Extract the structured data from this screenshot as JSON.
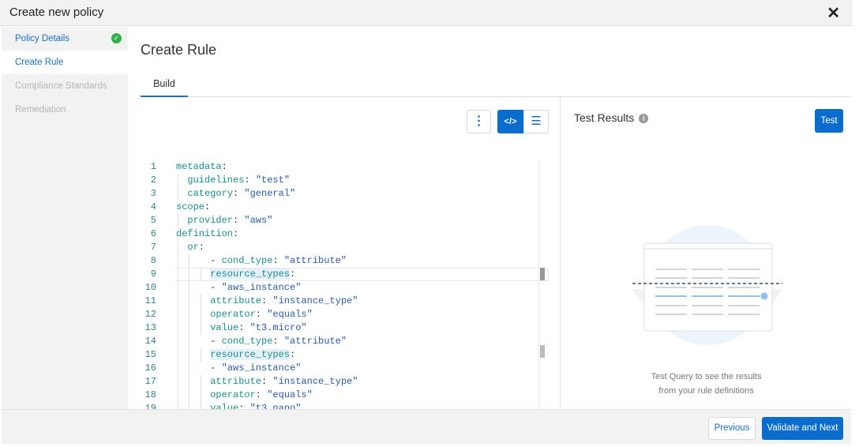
{
  "header": {
    "title": "Create new policy",
    "close_icon": "close-icon"
  },
  "sidebar": {
    "items": [
      {
        "label": "Policy Details",
        "state": "done"
      },
      {
        "label": "Create Rule",
        "state": "active"
      },
      {
        "label": "Compliance Standards",
        "state": "disabled"
      },
      {
        "label": "Remediation",
        "state": "disabled"
      }
    ]
  },
  "main": {
    "title": "Create Rule",
    "tabs": [
      {
        "label": "Build",
        "active": true
      }
    ]
  },
  "editor": {
    "active_line": 9,
    "lines": [
      {
        "n": "1",
        "indent": 0,
        "key": "metadata",
        "val": ""
      },
      {
        "n": "2",
        "indent": 1,
        "key": "guidelines",
        "val": "\"test\""
      },
      {
        "n": "3",
        "indent": 1,
        "key": "category",
        "val": "\"general\""
      },
      {
        "n": "4",
        "indent": 0,
        "key": "scope",
        "val": ""
      },
      {
        "n": "5",
        "indent": 1,
        "key": "provider",
        "val": "\"aws\""
      },
      {
        "n": "6",
        "indent": 0,
        "key": "definition",
        "val": ""
      },
      {
        "n": "7",
        "indent": 1,
        "key": "or",
        "val": ""
      },
      {
        "n": "8",
        "indent": 2,
        "dash": true,
        "key": "cond_type",
        "val": "\"attribute\""
      },
      {
        "n": "9",
        "indent": 3,
        "key": "resource_types",
        "val": "",
        "hl": true
      },
      {
        "n": "10",
        "indent": 3,
        "dash": true,
        "key": "",
        "val": "\"aws_instance\""
      },
      {
        "n": "11",
        "indent": 3,
        "key": "attribute",
        "val": "\"instance_type\""
      },
      {
        "n": "12",
        "indent": 3,
        "key": "operator",
        "val": "\"equals\""
      },
      {
        "n": "13",
        "indent": 3,
        "key": "value",
        "val": "\"t3.micro\""
      },
      {
        "n": "14",
        "indent": 2,
        "dash": true,
        "key": "cond_type",
        "val": "\"attribute\""
      },
      {
        "n": "15",
        "indent": 3,
        "key": "resource_types",
        "val": "",
        "hl": true
      },
      {
        "n": "16",
        "indent": 3,
        "dash": true,
        "key": "",
        "val": "\"aws_instance\""
      },
      {
        "n": "17",
        "indent": 3,
        "key": "attribute",
        "val": "\"instance_type\""
      },
      {
        "n": "18",
        "indent": 3,
        "key": "operator",
        "val": "\"equals\""
      },
      {
        "n": "19",
        "indent": 3,
        "key": "value",
        "val": "\"t3.nano\""
      }
    ]
  },
  "results": {
    "title": "Test Results",
    "test_label": "Test",
    "empty_line1": "Test Query to see the results",
    "empty_line2": "from your rule definitions"
  },
  "footer": {
    "previous_label": "Previous",
    "next_label": "Validate and Next"
  },
  "colors": {
    "accent": "#0a6ccc",
    "success": "#2db14b"
  }
}
